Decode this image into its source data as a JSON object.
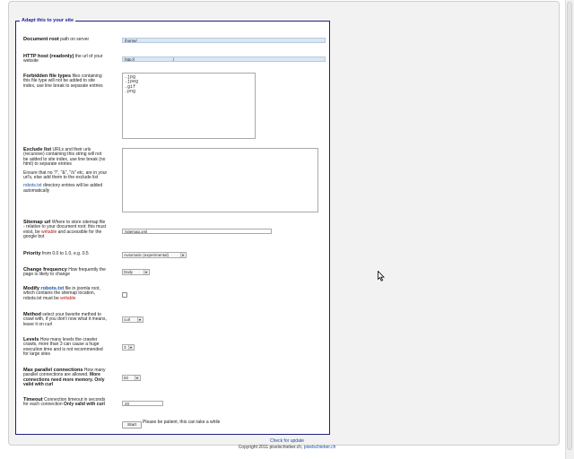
{
  "legend": "Adapt this to your site",
  "docroot": {
    "label": "Document root",
    "help": "path on server",
    "value": "/home/"
  },
  "host": {
    "label": "HTTP host (readonly)",
    "help": "the url of your website",
    "value": "http://                                  /"
  },
  "forbidden": {
    "label": "Forbidden file types",
    "help": "files containing this file type will not be added to site index, use line break to separate entries",
    "value": ".jpg\n.jpeg\n.gif\n.png"
  },
  "exclude": {
    "label": "Exclude list",
    "help": "URLs and their urls (recursive) containing this string will not be added to site index, use line break (no html) to separate entries",
    "help2": "Ensure that no \"/\", \"&\", \"/s\" etc. are in your url's, else add them to the exclude list",
    "robots_link": "robots.txt",
    "help3": " directory entries will be added automatically",
    "value": ""
  },
  "sitemap": {
    "label": "Sitemap url",
    "help": "Where to store sitemap file - relative to your document root; this must exist, be",
    "writable": "writable",
    "help_end": "and accessible for the google bot",
    "value": "/sitemap.xml"
  },
  "priority": {
    "label": "Priority",
    "help": "from 0.0 to 1.0, e.g. 0.5",
    "selected": "Automatic (experimental)"
  },
  "changefreq": {
    "label": "Change frequency",
    "help": "How frequently the page is likely to change",
    "selected": "Daily"
  },
  "modify": {
    "label": "Modify",
    "link": "robots.txt",
    "help": "file in joomla root, which contains the sitemap location, robots.txt must be",
    "writable": "writable"
  },
  "method": {
    "label": "Method",
    "help": "select your favorite method to crawl with, if you don't now what it means, leave it on curl",
    "selected": "curl"
  },
  "levels": {
    "label": "Levels",
    "help": "How many levels the crawler crawls, more than 3 can cause a huge execution time and is not recommended for large sites",
    "selected": "3"
  },
  "parallel": {
    "label": "Max parallel connections",
    "help": "How many parallel connections are allowed.",
    "help_bold": "More connections need more memory. Only valid with curl",
    "selected": "50"
  },
  "timeout": {
    "label": "Timeout",
    "help": "Connection timeout in seconds for each connection",
    "help_bold": "Only valid with curl",
    "value": "20"
  },
  "start": {
    "button": "Start",
    "note": "Please be patient, this can take a while"
  },
  "footer": {
    "update_link": "Check for update",
    "copyright": "Copyright 2011 pixelschieber.ch, ",
    "site_link": "pixelschieber.ch"
  },
  "colors": {
    "legend": "#1f1f9a",
    "link": "#1a4ea1",
    "writable": "#b4160c",
    "field_bg": "#d8e7f7"
  }
}
